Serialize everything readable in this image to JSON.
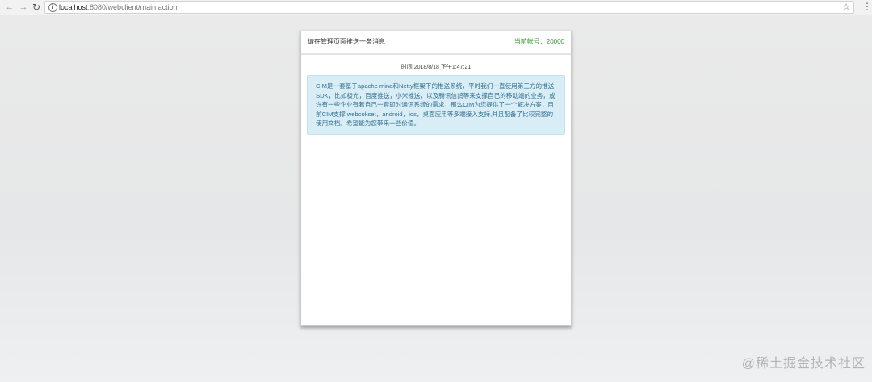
{
  "browser": {
    "back_icon": "arrow-left-icon",
    "forward_icon": "arrow-right-icon",
    "reload_icon": "reload-icon",
    "url_host": "localhost",
    "url_path": ":8080/webclient/main.action",
    "star_icon": "star-icon",
    "menu_icon": "vertical-dots-icon"
  },
  "card": {
    "title": "请在管理页面推送一条消息",
    "account": "当前帐号：20000",
    "account_color": "#3c9e3c"
  },
  "message": {
    "time": "时间:2018/8/18 下午1:47:21",
    "text": "CIM是一套基于apache mina和Netty框架下的推送系统，平时我们一直使用第三方的推送SDK，比如极光，百度推送，小米推送，以及腾讯信鸽等来支撑自己的移动端的业务，或许有一些企业有着自己一套即时通讯系统的需求，那么CIM为您提供了一个解决方案，目前CIM支撑 webcokset，android，ios，桌面应用等多端接入支持,并且配备了比较完整的使用文档。希望能为您带来一些价值。",
    "bubble_color": "#d9edf7",
    "text_color": "#31708f"
  },
  "watermark": "@稀土掘金技术社区"
}
